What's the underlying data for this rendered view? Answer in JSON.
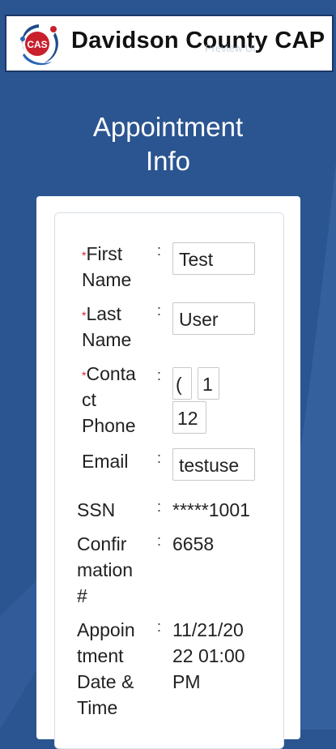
{
  "header": {
    "brand": "Davidson County CAP",
    "logo_text": "CAS",
    "watermark": "Preview UI"
  },
  "page": {
    "title_line1": "Appointment",
    "title_line2": "Info"
  },
  "form": {
    "first_name": {
      "label_l1": "First",
      "label_l2": "Name",
      "value": "Test",
      "required": true
    },
    "last_name": {
      "label_l1": "Last",
      "label_l2": "Name",
      "value": "User",
      "required": true
    },
    "contact_phone": {
      "label_l1": "Conta",
      "label_l2": "ct",
      "label_l3": "Phone",
      "values": [
        "(",
        "1",
        "12"
      ],
      "required": true
    },
    "email": {
      "label": "Email",
      "value": "testuse"
    },
    "ssn": {
      "label": "SSN",
      "value": "*****1001"
    },
    "confirmation": {
      "label_l1": "Confir",
      "label_l2": "mation",
      "label_l3": "#",
      "value": "6658"
    },
    "appointment": {
      "label_l1": "Appoin",
      "label_l2": "tment",
      "label_l3": "Date &",
      "label_l4": "Time",
      "value_l1": "11/21/20",
      "value_l2": "22 01:00",
      "value_l3": "PM"
    },
    "colon": ":",
    "required_mark": "*"
  },
  "colors": {
    "background": "#2b5591",
    "required": "#d0282a"
  }
}
